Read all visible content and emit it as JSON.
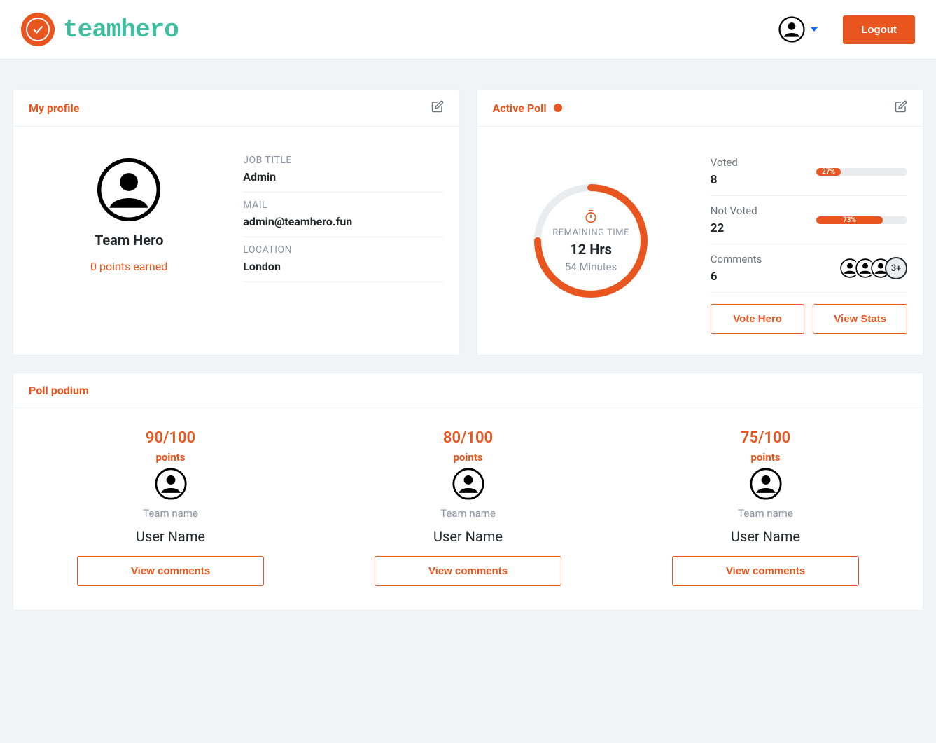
{
  "brand": {
    "name": "teamhero"
  },
  "header": {
    "logout_label": "Logout"
  },
  "profile_card": {
    "title": "My profile",
    "name": "Team Hero",
    "points_text": "0 points earned",
    "fields": {
      "job_title_label": "JOB TITLE",
      "job_title_value": "Admin",
      "mail_label": "MAIL",
      "mail_value": "admin@teamhero.fun",
      "location_label": "LOCATION",
      "location_value": "London"
    }
  },
  "poll_card": {
    "title": "Active Poll",
    "remaining_label": "REMAINING TIME",
    "hours_text": "12 Hrs",
    "minutes_text": "54 Minutes",
    "voted": {
      "label": "Voted",
      "value": "8",
      "percent_text": "27%",
      "percent": 27
    },
    "not_voted": {
      "label": "Not Voted",
      "value": "22",
      "percent_text": "73%",
      "percent": 73
    },
    "comments": {
      "label": "Comments",
      "value": "6",
      "more_text": "3+"
    },
    "actions": {
      "vote_label": "Vote Hero",
      "stats_label": "View Stats"
    }
  },
  "podium_card": {
    "title": "Poll podium",
    "points_word": "points",
    "entries": [
      {
        "score": "90/100",
        "team": "Team name",
        "user": "User Name",
        "button": "View comments"
      },
      {
        "score": "80/100",
        "team": "Team name",
        "user": "User Name",
        "button": "View comments"
      },
      {
        "score": "75/100",
        "team": "Team name",
        "user": "User Name",
        "button": "View comments"
      }
    ]
  },
  "colors": {
    "accent": "#e8551e",
    "teal": "#3fbf9f"
  }
}
